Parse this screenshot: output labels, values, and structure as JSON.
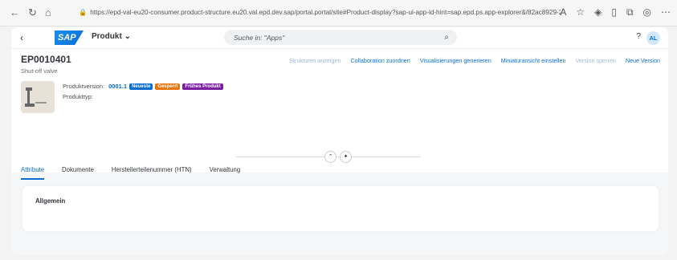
{
  "browser": {
    "url": "https://epd-val-eu20-consumer.product-structure.eu20.val.epd.dev.sap/portal.portal/site#Product-display?sap-ui-app-id-hint=sap.epd.ps.app-explorer&/82ac8929-2a...",
    "icons": [
      "back-icon",
      "refresh-icon",
      "home-icon",
      "read-aloud-icon",
      "favorite-icon",
      "extensions-icon",
      "split-icon",
      "collections-icon",
      "profile-icon",
      "more-icon"
    ]
  },
  "shell": {
    "product_menu": "Produkt",
    "search_placeholder": "Suche in: \"Apps\"",
    "avatar_initials": "AL"
  },
  "header": {
    "title": "EP0010401",
    "subtitle": "Shut-off valve",
    "actions": [
      {
        "label": "Strukturen anzeigen",
        "disabled": true
      },
      {
        "label": "Collaboration zuordnen",
        "disabled": false
      },
      {
        "label": "Visualisierungen generieren",
        "disabled": false
      },
      {
        "label": "Miniaturansicht einstellen",
        "disabled": false
      },
      {
        "label": "Version sperren",
        "disabled": true
      },
      {
        "label": "Neue Version",
        "disabled": false
      }
    ],
    "product_version_label": "Produktversion:",
    "product_version": "0001.1",
    "badges": [
      "Neueste",
      "Gesperrt",
      "Frühes Produkt"
    ],
    "product_type_label": "Produkttyp:"
  },
  "tabs": [
    "Attribute",
    "Dokumente",
    "Herstellerteilenummer (HTN)",
    "Verwaltung"
  ],
  "section": {
    "title": "Allgemein"
  },
  "colors": {
    "accent": "#0a6ed1",
    "badge_new": "#0a6ed1",
    "badge_locked": "#e9730c",
    "badge_early": "#7b1fa2"
  }
}
